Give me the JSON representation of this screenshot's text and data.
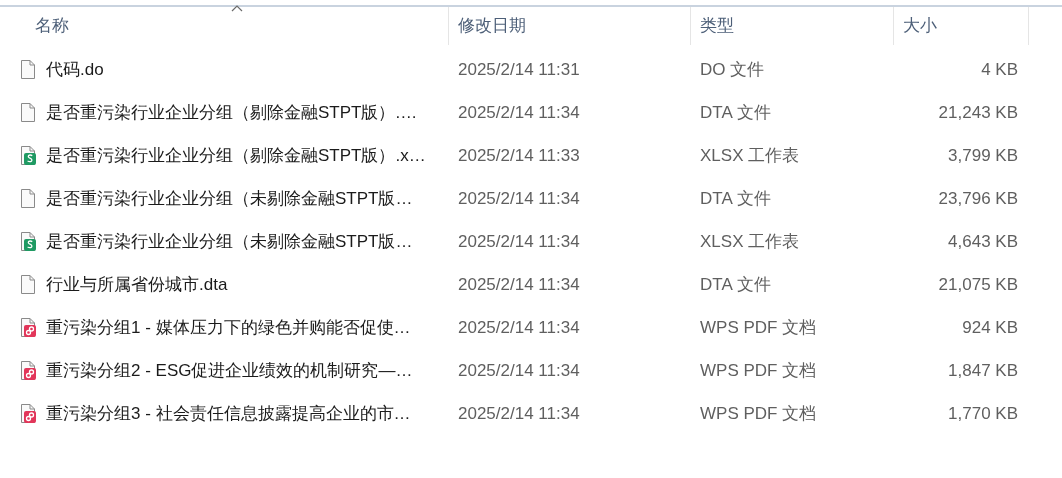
{
  "columns": [
    {
      "label": "名称",
      "sorted": true
    },
    {
      "label": "修改日期",
      "sorted": false
    },
    {
      "label": "类型",
      "sorted": false
    },
    {
      "label": "大小",
      "sorted": false
    }
  ],
  "files": [
    {
      "kind": "file",
      "name": "代码.do",
      "modified": "2025/2/14 11:31",
      "type": "DO 文件",
      "size": "4 KB"
    },
    {
      "kind": "file",
      "name": "是否重污染行业企业分组（剔除金融STPT版）.…",
      "modified": "2025/2/14 11:34",
      "type": "DTA 文件",
      "size": "21,243 KB"
    },
    {
      "kind": "sheet",
      "name": "是否重污染行业企业分组（剔除金融STPT版）.x…",
      "modified": "2025/2/14 11:33",
      "type": "XLSX 工作表",
      "size": "3,799 KB"
    },
    {
      "kind": "file",
      "name": "是否重污染行业企业分组（未剔除金融STPT版…",
      "modified": "2025/2/14 11:34",
      "type": "DTA 文件",
      "size": "23,796 KB"
    },
    {
      "kind": "sheet",
      "name": "是否重污染行业企业分组（未剔除金融STPT版…",
      "modified": "2025/2/14 11:34",
      "type": "XLSX 工作表",
      "size": "4,643 KB"
    },
    {
      "kind": "file",
      "name": "行业与所属省份城市.dta",
      "modified": "2025/2/14 11:34",
      "type": "DTA 文件",
      "size": "21,075 KB"
    },
    {
      "kind": "pdf",
      "name": "重污染分组1 - 媒体压力下的绿色并购能否促使…",
      "modified": "2025/2/14 11:34",
      "type": "WPS PDF 文档",
      "size": "924 KB"
    },
    {
      "kind": "pdf",
      "name": "重污染分组2 - ESG促进企业绩效的机制研究—…",
      "modified": "2025/2/14 11:34",
      "type": "WPS PDF 文档",
      "size": "1,847 KB"
    },
    {
      "kind": "pdf",
      "name": "重污染分组3 - 社会责任信息披露提高企业的市…",
      "modified": "2025/2/14 11:34",
      "type": "WPS PDF 文档",
      "size": "1,770 KB"
    }
  ]
}
